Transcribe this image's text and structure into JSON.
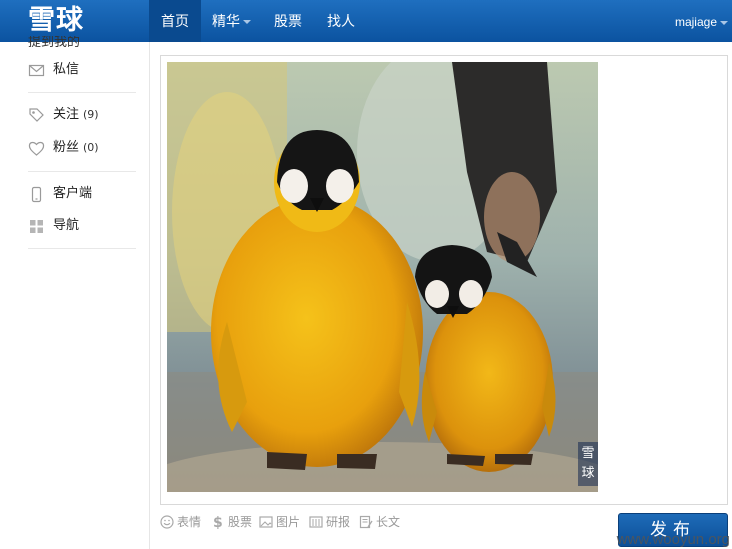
{
  "header": {
    "logo": "雪球",
    "nav": [
      {
        "label": "首页",
        "active": true
      },
      {
        "label": "精华",
        "dropdown": true
      },
      {
        "label": "股票"
      },
      {
        "label": "找人"
      }
    ],
    "user": "majiage"
  },
  "sidebar": {
    "cut_item": "提到我的",
    "items": [
      {
        "label": "私信",
        "icon": "mail-icon"
      },
      {
        "label": "关注",
        "count": "(9)",
        "icon": "tag-icon"
      },
      {
        "label": "粉丝",
        "count": "(0)",
        "icon": "heart-icon"
      },
      {
        "label": "客户端",
        "icon": "phone-icon"
      },
      {
        "label": "导航",
        "icon": "grid-icon"
      }
    ]
  },
  "editor": {
    "image_watermark": "雪球",
    "toolbar": [
      {
        "label": "表情",
        "icon": "smile-icon"
      },
      {
        "label": "股票",
        "icon": "dollar-icon"
      },
      {
        "label": "图片",
        "icon": "image-icon"
      },
      {
        "label": "研报",
        "icon": "report-icon"
      },
      {
        "label": "长文",
        "icon": "longtext-icon"
      }
    ],
    "publish_label": "发布"
  },
  "page_watermark": "www.wooyun.org",
  "colors": {
    "nav_bar": "#0b53a0",
    "publish_button": "#1560ad"
  }
}
